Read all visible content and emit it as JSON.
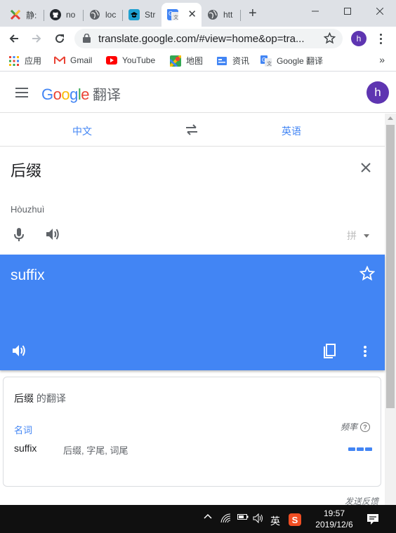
{
  "browser": {
    "tabs": [
      {
        "label": "静:",
        "favicon": "colorful-x-icon",
        "color": "#e53935"
      },
      {
        "label": "no",
        "favicon": "github-icon",
        "color": "#24292e"
      },
      {
        "label": "loc",
        "favicon": "globe-icon",
        "color": "#5f6368"
      },
      {
        "label": "Str",
        "favicon": "graduation-cap-icon",
        "color": "#1fa0d0"
      },
      {
        "label": "",
        "favicon": "google-translate-icon",
        "color": "#4285f4",
        "active": true
      },
      {
        "label": "htt",
        "favicon": "globe-icon",
        "color": "#5f6368"
      }
    ],
    "new_tab_label": "+",
    "url": "translate.google.com/#view=home&op=tra...",
    "profile_initial": "h",
    "bookmarks": [
      {
        "label": "应用",
        "icon": "apps-grid-icon"
      },
      {
        "label": "Gmail",
        "icon": "gmail-icon"
      },
      {
        "label": "YouTube",
        "icon": "youtube-icon"
      },
      {
        "label": "地图",
        "icon": "maps-icon"
      },
      {
        "label": "资讯",
        "icon": "news-icon"
      },
      {
        "label": "Google 翻译",
        "icon": "google-translate-icon"
      }
    ],
    "bookmarks_more": "»"
  },
  "app": {
    "logo": {
      "letters": [
        {
          "ch": "G",
          "color": "#4285f4"
        },
        {
          "ch": "o",
          "color": "#ea4335"
        },
        {
          "ch": "o",
          "color": "#fbbc05"
        },
        {
          "ch": "g",
          "color": "#4285f4"
        },
        {
          "ch": "l",
          "color": "#34a853"
        },
        {
          "ch": "e",
          "color": "#ea4335"
        }
      ],
      "product": "翻译"
    },
    "avatar_initial": "h",
    "source_lang": "中文",
    "target_lang": "英语",
    "source_text": "后缀",
    "transliteration": "Hòuzhuì",
    "ime_label": "拼",
    "result_text": "suffix",
    "accent_color": "#4285f4"
  },
  "dictionary": {
    "title_word": "后缀",
    "title_suffix": " 的翻译",
    "part_of_speech": "名词",
    "frequency_label": "频率",
    "help_glyph": "?",
    "entries": [
      {
        "word": "suffix",
        "synonyms": "后缀, 字尾, 词尾",
        "frequency": 3
      }
    ]
  },
  "feedback_label": "发送反馈",
  "taskbar": {
    "ime": "英",
    "sogou": "S",
    "time": "19:57",
    "date": "2019/12/6"
  }
}
